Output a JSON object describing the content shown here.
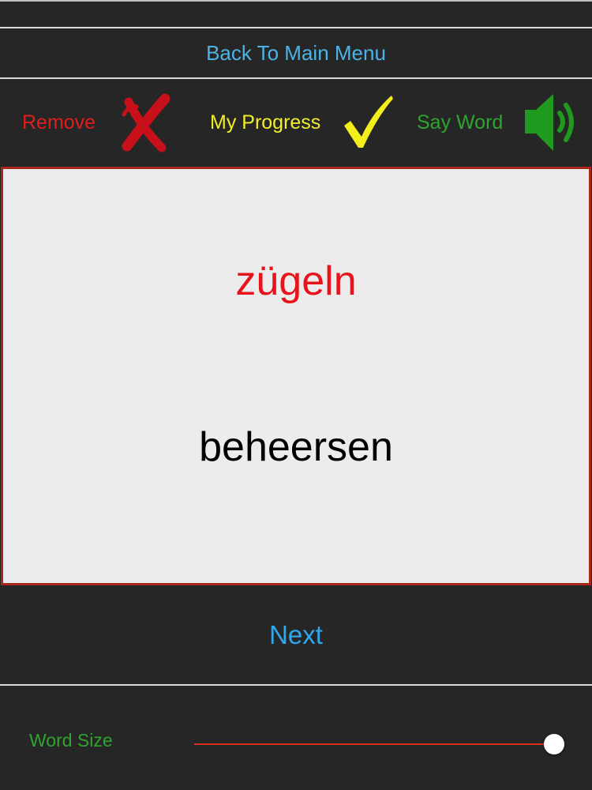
{
  "navigation": {
    "back_label": "Back To Main Menu"
  },
  "toolbar": {
    "remove_label": "Remove",
    "remove_icon": "cross-icon",
    "progress_label": "My Progress",
    "progress_icon": "checkmark-icon",
    "say_word_label": "Say Word",
    "say_word_icon": "speaker-icon"
  },
  "card": {
    "foreign_word": "zügeln",
    "translation": "beheersen"
  },
  "next_label": "Next",
  "word_size": {
    "label": "Word Size",
    "value_fraction": 1.0
  },
  "colors": {
    "link": "#4db3e6",
    "remove": "#e01e1e",
    "progress": "#f2ee2a",
    "say_word": "#2fa52f",
    "foreign_word": "#e8141c",
    "card_border": "#a8261a",
    "slider_fill": "#d4321e"
  }
}
